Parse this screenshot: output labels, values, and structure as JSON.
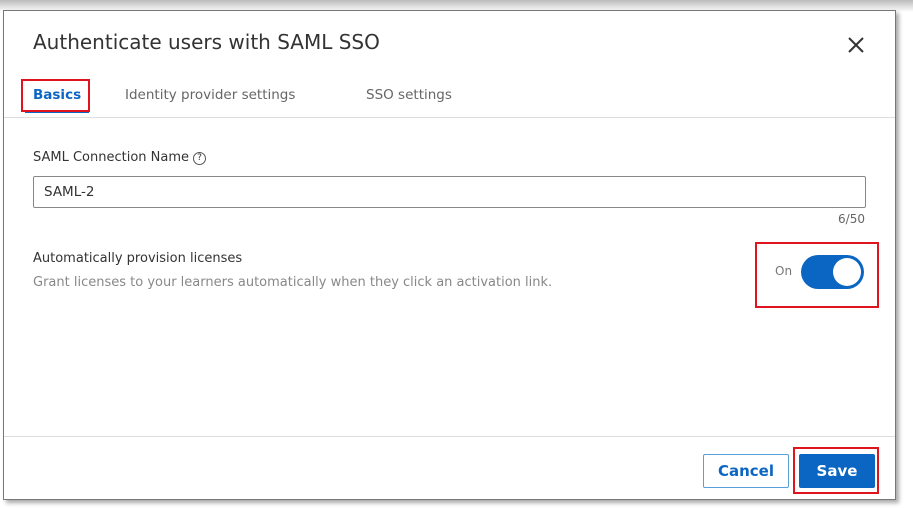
{
  "dialog": {
    "title": "Authenticate users with SAML SSO",
    "close_icon": "close-icon"
  },
  "tabs": [
    {
      "label": "Basics",
      "active": true
    },
    {
      "label": "Identity provider settings"
    },
    {
      "label": "SSO settings"
    }
  ],
  "connection": {
    "label": "SAML Connection Name",
    "help_icon": "?",
    "value": "SAML-2",
    "counter": "6/50"
  },
  "provision": {
    "label": "Automatically provision licenses",
    "description": "Grant licenses to your learners automatically when they click an activation link.",
    "toggle_label": "On",
    "toggle_on": true
  },
  "footer": {
    "cancel": "Cancel",
    "save": "Save"
  },
  "colors": {
    "accent": "#0a66c2",
    "highlight": "#e0141e"
  }
}
